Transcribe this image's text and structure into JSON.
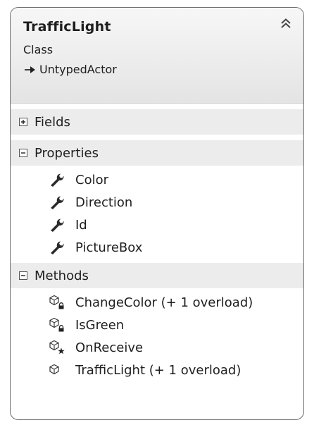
{
  "class": {
    "name": "TrafficLight",
    "stereotype": "Class",
    "base": "UntypedActor",
    "collapse_icon": "double-chevron-up-icon"
  },
  "sections": {
    "fields": {
      "label": "Fields",
      "state": "collapsed",
      "toggle_icon": "expand-plus-icon"
    },
    "properties": {
      "label": "Properties",
      "state": "expanded",
      "toggle_icon": "collapse-minus-icon",
      "items": [
        {
          "name": "Color",
          "icon": "wrench-property-icon"
        },
        {
          "name": "Direction",
          "icon": "wrench-property-icon"
        },
        {
          "name": "Id",
          "icon": "wrench-property-icon"
        },
        {
          "name": "PictureBox",
          "icon": "wrench-property-icon"
        }
      ]
    },
    "methods": {
      "label": "Methods",
      "state": "expanded",
      "toggle_icon": "collapse-minus-icon",
      "items": [
        {
          "name": "ChangeColor (+ 1 overload)",
          "icon": "private-method-icon"
        },
        {
          "name": "IsGreen",
          "icon": "private-method-icon"
        },
        {
          "name": "OnReceive",
          "icon": "protected-method-icon"
        },
        {
          "name": "TrafficLight (+ 1 overload)",
          "icon": "public-method-icon"
        }
      ]
    }
  },
  "colors": {
    "border": "#6e6e6e",
    "header_gradient_top": "#f7f7f7",
    "header_gradient_bottom": "#e4e4e4",
    "section_header_bg": "#ececec",
    "text": "#1e1e1e"
  }
}
